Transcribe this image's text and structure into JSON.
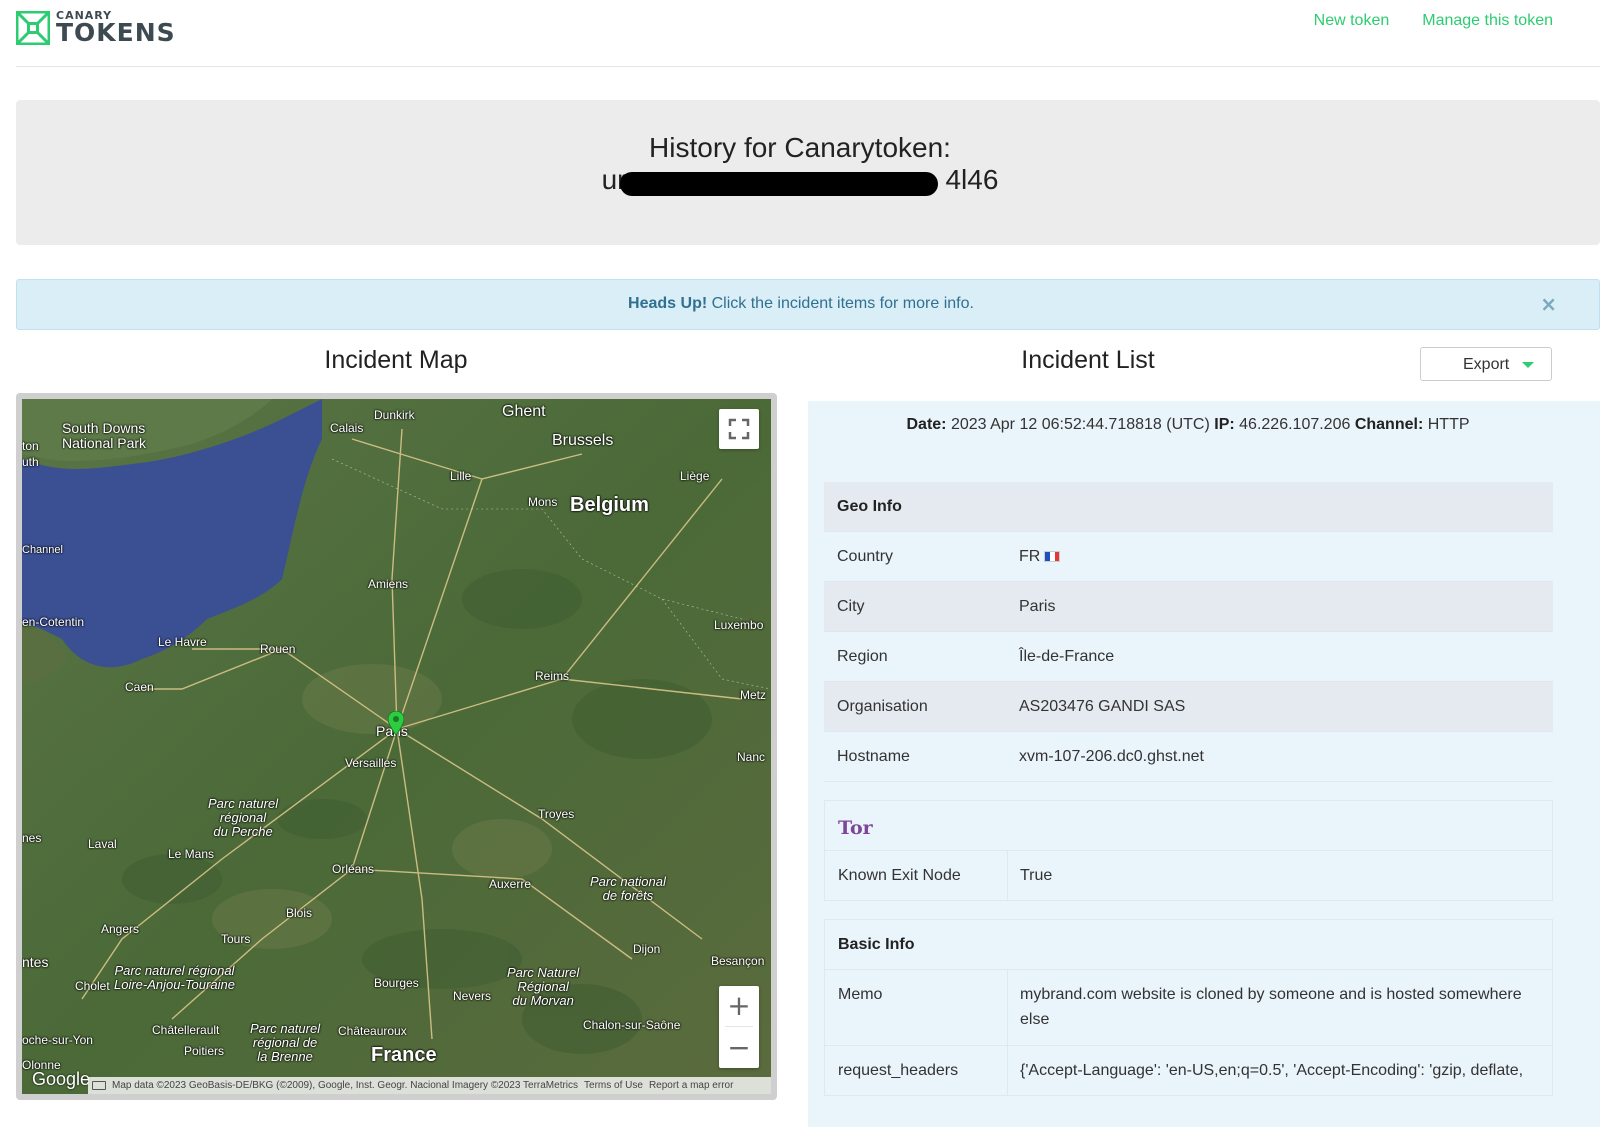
{
  "brand": {
    "small": "CANARY",
    "big": "TOKENS",
    "green": "#2ecc71",
    "dark": "#3e4a52"
  },
  "nav": {
    "new_token": "New token",
    "manage": "Manage this token"
  },
  "title": {
    "line1": "History for Canarytoken:",
    "line2_start": "ur",
    "line2_end": "4l46"
  },
  "alert": {
    "strong": "Heads Up!",
    "text": " Click the incident items for more info.",
    "close": "×"
  },
  "sections": {
    "map": "Incident Map",
    "list": "Incident List",
    "export": "Export"
  },
  "map": {
    "labels": {
      "south_downs": "South Downs",
      "national_park": "National Park",
      "ton": "ton",
      "uth": "uth",
      "channel": "Channel",
      "cotentin": "en-Cotentin",
      "calais": "Calais",
      "dunkirk": "Dunkirk",
      "ghent": "Ghent",
      "brussels": "Brussels",
      "lille": "Lille",
      "liege": "Liège",
      "mons": "Mons",
      "belgium": "Belgium",
      "amiens": "Amiens",
      "le_havre": "Le Havre",
      "rouen": "Rouen",
      "luxembo": "Luxembo",
      "caen": "Caen",
      "reims": "Reims",
      "metz": "Metz",
      "paris": "Paris",
      "versailles": "Versailles",
      "nanc": "Nanc",
      "parc_perche": "Parc naturel\nrégional\ndu Perche",
      "troyes": "Troyes",
      "laval": "Laval",
      "nes": "nes",
      "le_mans": "Le Mans",
      "orleans": "Orléans",
      "auxerre": "Auxerre",
      "parc_forets": "Parc national\nde forêts",
      "blois": "Blois",
      "angers": "Angers",
      "tours": "Tours",
      "dijon": "Dijon",
      "antes": "ntes",
      "parc_loire": "Parc naturel régional\nLoire-Anjou-Touraine",
      "cholet": "Cholet",
      "besancon": "Besançon",
      "bourges": "Bourges",
      "parc_morvan": "Parc Naturel\nRégional\ndu Morvan",
      "nevers": "Nevers",
      "chatellerault": "Châtellerault",
      "parc_brenne": "Parc naturel\nrégional de\nla Brenne",
      "chateauroux": "Châteauroux",
      "chalon": "Chalon-sur-Saône",
      "oche_sur_yon": "oche-sur-Yon",
      "poitiers": "Poitiers",
      "france": "France",
      "olonne": "Olonne"
    },
    "google": "Google",
    "attribution": "Map data ©2023 GeoBasis-DE/BKG (©2009), Google, Inst. Geogr. Nacional Imagery ©2023 TerraMetrics",
    "terms": "Terms of Use",
    "report": "Report a map error",
    "zoom_in": "+",
    "zoom_out": "−",
    "marker_color": "#2ecc40"
  },
  "incident": {
    "date_label": "Date:",
    "date": "2023 Apr 12 06:52:44.718818 (UTC)",
    "ip_label": "IP:",
    "ip": "46.226.107.206",
    "channel_label": "Channel:",
    "channel": "HTTP",
    "geo_header": "Geo Info",
    "geo": [
      {
        "key": "Country",
        "value": "FR"
      },
      {
        "key": "City",
        "value": "Paris"
      },
      {
        "key": "Region",
        "value": "Île-de-France"
      },
      {
        "key": "Organisation",
        "value": "AS203476 GANDI SAS"
      },
      {
        "key": "Hostname",
        "value": "xvm-107-206.dc0.ghst.net"
      }
    ],
    "tor_logo": "Tor",
    "tor": {
      "key": "Known Exit Node",
      "value": "True"
    },
    "basic_header": "Basic Info",
    "basic": [
      {
        "key": "Memo",
        "value": "mybrand.com website is cloned by someone and is hosted somewhere else"
      },
      {
        "key": "request_headers",
        "value": "{'Accept-Language': 'en-US,en;q=0.5', 'Accept-Encoding': 'gzip, deflate,"
      }
    ]
  }
}
